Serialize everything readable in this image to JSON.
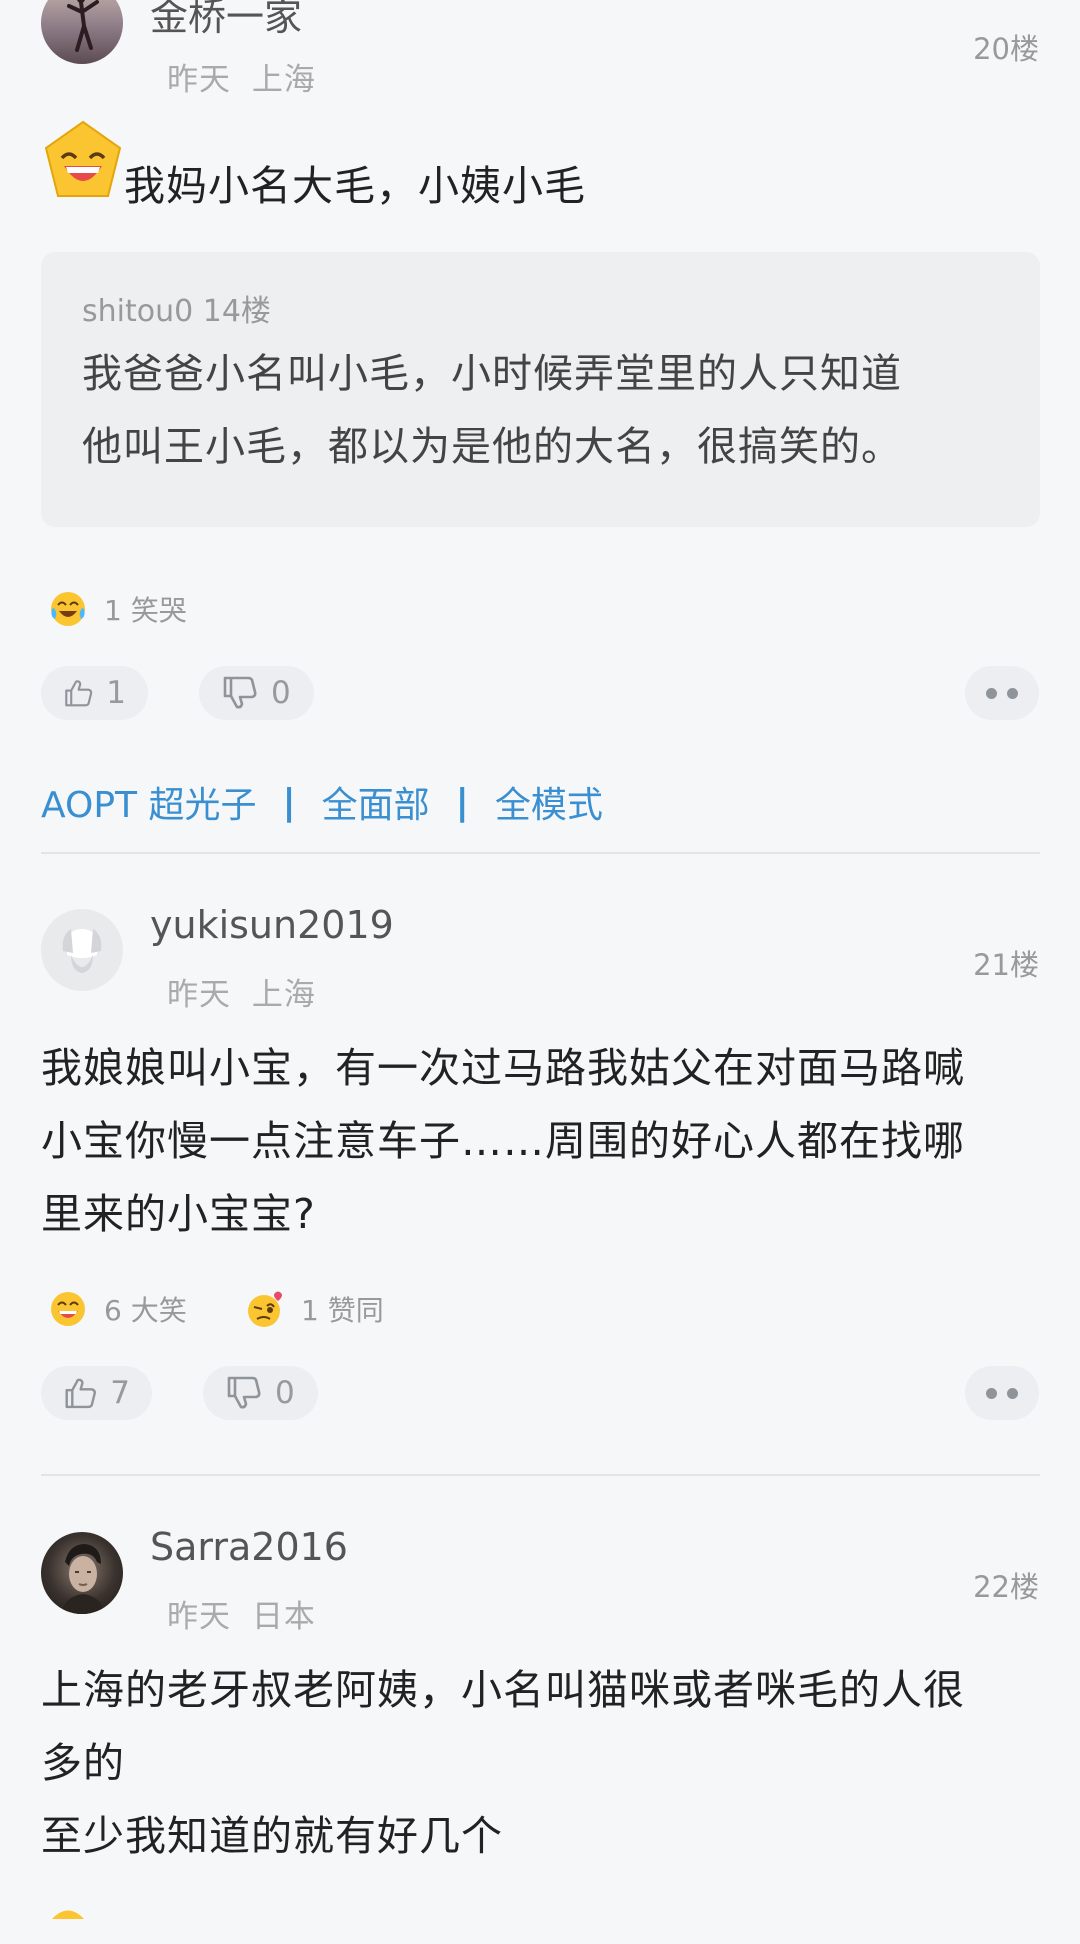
{
  "comments": [
    {
      "username": "金桥一家",
      "time": "昨天",
      "location": "上海",
      "floor": "20楼",
      "content": "我妈小名大毛，小姨小毛",
      "quote": {
        "user": "shitou0 14楼",
        "text_line1": "我爸爸小名叫小毛，小时候弄堂里的人只知道",
        "text_line2": "他叫王小毛，都以为是他的大名，很搞笑的。"
      },
      "reactions": [
        {
          "count_label": "1 笑哭",
          "icon": "laugh-cry-emoji"
        }
      ],
      "likes": "1",
      "dislikes": "0"
    },
    {
      "username": "yukisun2019",
      "time": "昨天",
      "location": "上海",
      "floor": "21楼",
      "content_line1": "我娘娘叫小宝，有一次过马路我姑父在对面马路喊",
      "content_line2": "小宝你慢一点注意车子……周围的好心人都在找哪",
      "content_line3": "里来的小宝宝?",
      "reactions": [
        {
          "count_label": "6 大笑",
          "icon": "grin-emoji"
        },
        {
          "count_label": "1 赞同",
          "icon": "heart-wink-emoji"
        }
      ],
      "likes": "7",
      "dislikes": "0"
    },
    {
      "username": "Sarra2016",
      "time": "昨天",
      "location": "日本",
      "floor": "22楼",
      "content_line1": "上海的老牙叔老阿姨，小名叫猫咪或者咪毛的人很",
      "content_line2": "多的",
      "content_line3": "至少我知道的就有好几个"
    }
  ],
  "device_links": {
    "link1": "AOPT 超光子",
    "link2": "全面部",
    "link3": "全模式",
    "separator": "|"
  },
  "colors": {
    "background": "#f6f7f9",
    "link": "#3a8fd0",
    "pill": "#eceef1",
    "quote_bg": "#eeeff1"
  }
}
